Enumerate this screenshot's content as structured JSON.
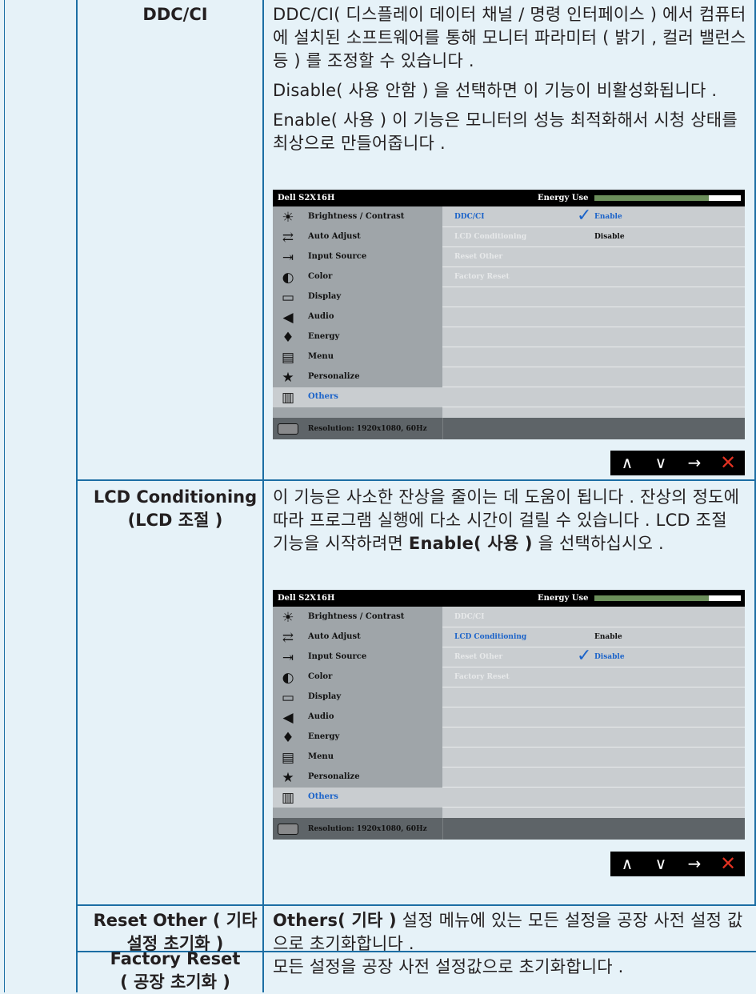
{
  "rows": [
    {
      "label": [
        "DDC/CI"
      ],
      "paragraphs": [
        "DDC/CI( 디스플레이 데이터 채널 / 명령 인터페이스 ) 에서 컴퓨터에 설치된 소프트웨어를 통해 모니터 파라미터 ( 밝기 , 컬러 밸런스 등 ) 를 조정할 수 있습니다 .",
        "Disable( 사용 안함 ) 을 선택하면 이 기능이 비활성화됩니다 .",
        "Enable( 사용 ) 이 기능은 모니터의 성능 최적화해서 시청 상태를 최상으로 만들어줍니다 ."
      ]
    },
    {
      "label": [
        "LCD Conditioning",
        "(LCD 조절 )"
      ],
      "paragraph_pre": "이 기능은 사소한 잔상을 줄이는 데 도움이 됩니다 . 잔상의 정도에 따라 프로그램 실행에 다소 시간이 걸릴 수 있습니다 . LCD 조절 기능을 시작하려면 ",
      "paragraph_bold": "Enable( 사용 )",
      "paragraph_post": " 을 선택하십시오 ."
    },
    {
      "label": [
        "Reset Other ( 기타",
        "설정 초기화 )"
      ],
      "paragraph_bold": "Others( 기타 )",
      "paragraph_post": " 설정 메뉴에 있는 모든 설정을 공장 사전 설정 값으로 초기화합니다 ."
    },
    {
      "label": [
        "Factory Reset",
        "( 공장 초기화 )"
      ],
      "paragraph": "모든 설정을 공장 사전 설정값으로 초기화합니다 ."
    }
  ],
  "osd": {
    "title": "Dell S2X16H",
    "energy_label": "Energy Use",
    "energy_level": 0.78,
    "menu": [
      {
        "label": "Brightness / Contrast",
        "icon": "brightness-icon"
      },
      {
        "label": "Auto Adjust",
        "icon": "auto-adjust-icon"
      },
      {
        "label": "Input Source",
        "icon": "input-source-icon"
      },
      {
        "label": "Color",
        "icon": "color-icon"
      },
      {
        "label": "Display",
        "icon": "display-icon"
      },
      {
        "label": "Audio",
        "icon": "audio-icon"
      },
      {
        "label": "Energy",
        "icon": "energy-icon"
      },
      {
        "label": "Menu",
        "icon": "menu-icon"
      },
      {
        "label": "Personalize",
        "icon": "personalize-icon"
      },
      {
        "label": "Others",
        "icon": "others-icon"
      }
    ],
    "selected_menu": "Others",
    "submenu": [
      "DDC/CI",
      "LCD Conditioning",
      "Reset Other",
      "Factory Reset"
    ],
    "options": [
      "Enable",
      "Disable"
    ],
    "resolution": "Resolution: 1920x1080, 60Hz",
    "screens": [
      {
        "active_submenu": "DDC/CI",
        "checked_option": "Enable"
      },
      {
        "active_submenu": "LCD Conditioning",
        "checked_option": "Disable"
      }
    ]
  },
  "buttons": [
    {
      "glyph": "∧",
      "icon": "up-icon"
    },
    {
      "glyph": "∨",
      "icon": "down-icon"
    },
    {
      "glyph": "→",
      "icon": "right-arrow-icon"
    },
    {
      "glyph": "✕",
      "icon": "exit-icon"
    }
  ],
  "colors": {
    "accent": "#1b63c9",
    "grid": "#1c6ea4",
    "exit": "#e23222"
  }
}
